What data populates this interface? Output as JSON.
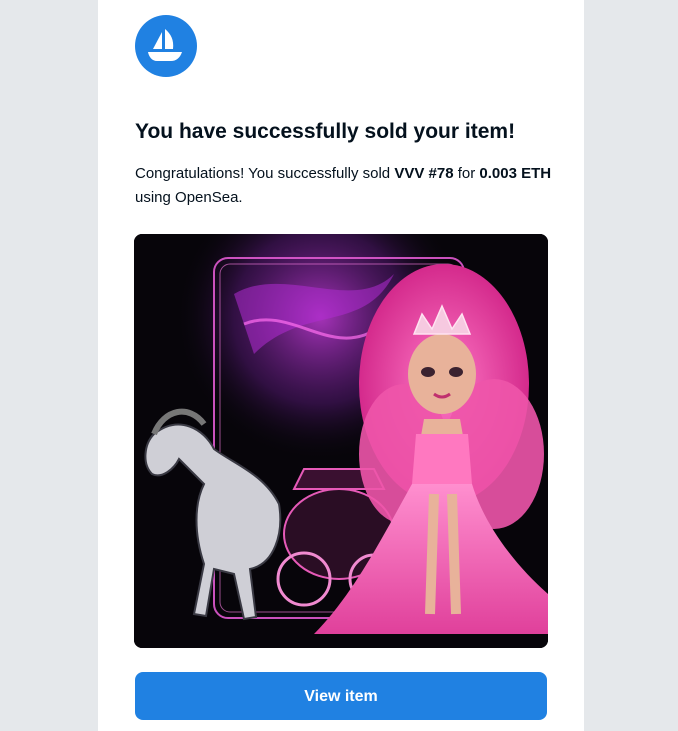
{
  "email": {
    "logo_icon": "opensea-logo-icon",
    "title": "You have successfully sold your item!",
    "message": {
      "prefix": "Congratulations! You successfully sold ",
      "item_name": "VVV #78",
      "middle": " for ",
      "price": "0.003 ETH",
      "suffix": " using OpenSea."
    },
    "nft_image_icon": "nft-artwork",
    "view_button_label": "View item"
  },
  "colors": {
    "brand_blue": "#2081e2",
    "page_background": "#e5e8eb",
    "text": "#04111d"
  }
}
